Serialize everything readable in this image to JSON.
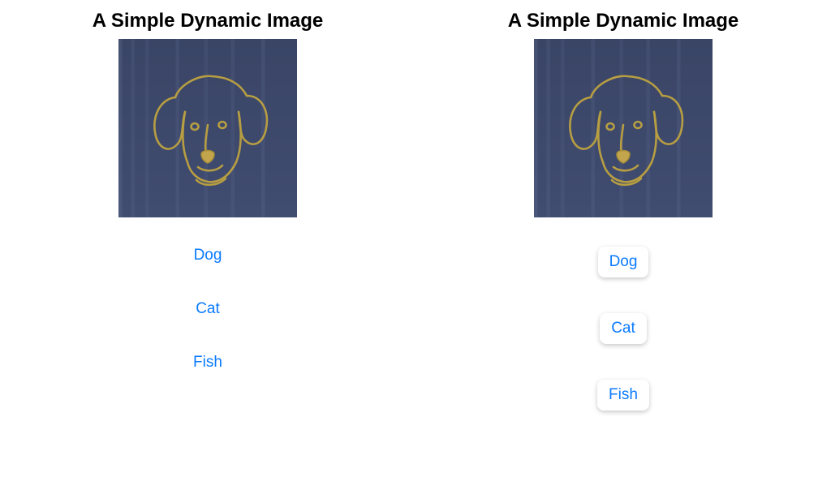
{
  "left": {
    "title": "A Simple Dynamic Image",
    "image": {
      "subject": "dog",
      "line_color": "#b79e42",
      "nose_fill": "#c2a54c",
      "background": "#3c4768"
    },
    "buttons": [
      {
        "label": "Dog",
        "style": "link"
      },
      {
        "label": "Cat",
        "style": "link"
      },
      {
        "label": "Fish",
        "style": "link"
      }
    ]
  },
  "right": {
    "title": "A Simple Dynamic Image",
    "image": {
      "subject": "dog",
      "line_color": "#b79e42",
      "nose_fill": "#c2a54c",
      "background": "#3c4768"
    },
    "buttons": [
      {
        "label": "Dog",
        "style": "card"
      },
      {
        "label": "Cat",
        "style": "card"
      },
      {
        "label": "Fish",
        "style": "card"
      }
    ]
  }
}
